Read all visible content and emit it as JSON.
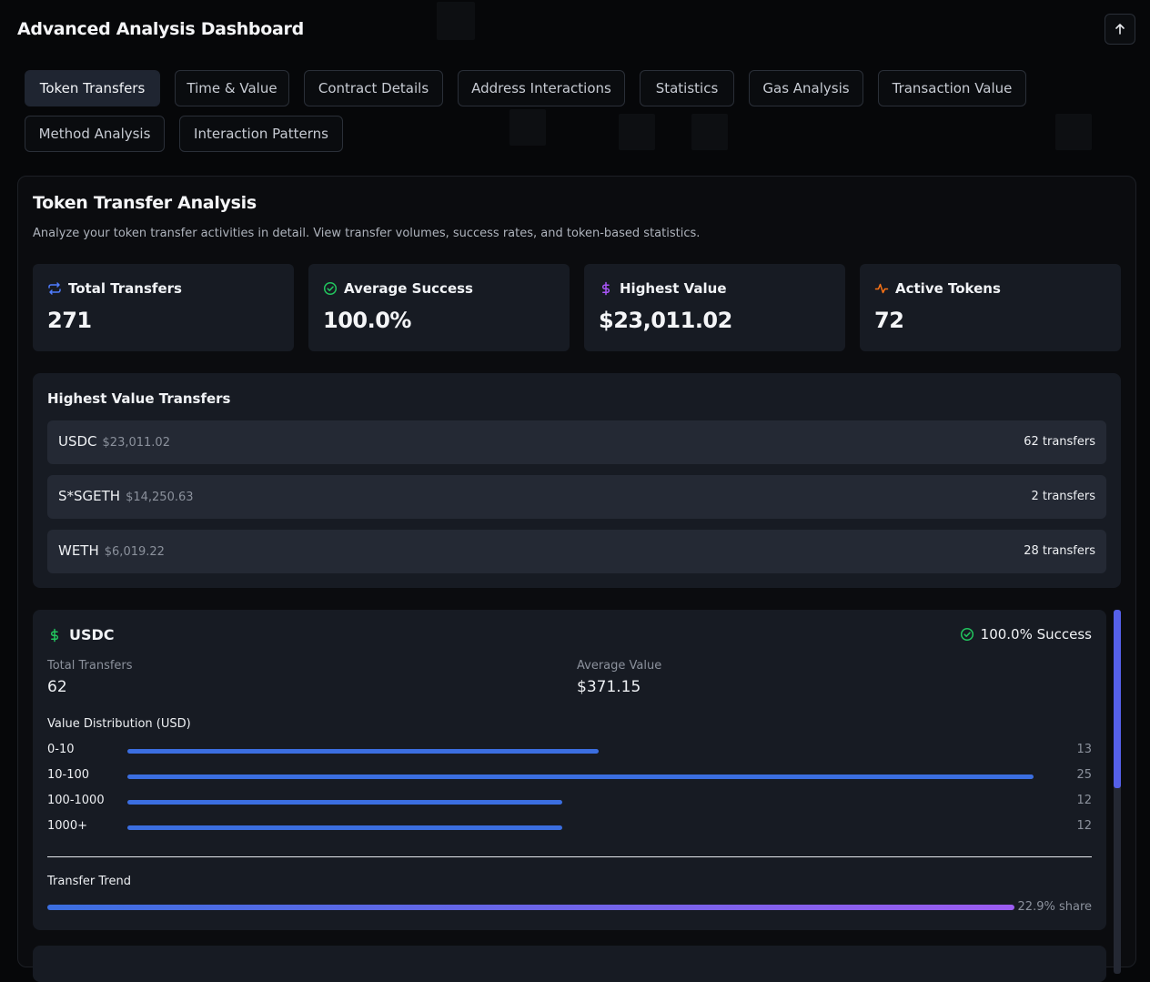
{
  "header": {
    "title": "Advanced Analysis Dashboard"
  },
  "tabs": [
    {
      "label": "Token Transfers",
      "active": true
    },
    {
      "label": "Time & Value"
    },
    {
      "label": "Contract Details"
    },
    {
      "label": "Address Interactions"
    },
    {
      "label": "Statistics"
    },
    {
      "label": "Gas Analysis"
    },
    {
      "label": "Transaction Value"
    },
    {
      "label": "Method Analysis"
    },
    {
      "label": "Interaction Patterns"
    }
  ],
  "panel": {
    "title": "Token Transfer Analysis",
    "description": "Analyze your token transfer activities in detail. View transfer volumes, success rates, and token-based statistics."
  },
  "stats": [
    {
      "label": "Total Transfers",
      "value": "271",
      "icon": "repeat-icon",
      "color": "#4f7cff"
    },
    {
      "label": "Average Success",
      "value": "100.0%",
      "icon": "check-circle-icon",
      "color": "#22c55e"
    },
    {
      "label": "Highest Value",
      "value": "$23,011.02",
      "icon": "dollar-icon",
      "color": "#a855f7"
    },
    {
      "label": "Active Tokens",
      "value": "72",
      "icon": "activity-icon",
      "color": "#f97316"
    }
  ],
  "highest_value": {
    "title": "Highest Value Transfers",
    "rows": [
      {
        "token": "USDC",
        "amount": "$23,011.02",
        "count": "62 transfers"
      },
      {
        "token": "S*SGETH",
        "amount": "$14,250.63",
        "count": "2 transfers"
      },
      {
        "token": "WETH",
        "amount": "$6,019.22",
        "count": "28 transfers"
      }
    ]
  },
  "token_card": {
    "token": "USDC",
    "success": "100.0% Success",
    "total_label": "Total Transfers",
    "total_value": "62",
    "avg_label": "Average Value",
    "avg_value": "$371.15",
    "dist_title": "Value Distribution (USD)",
    "distribution": [
      {
        "range": "0-10",
        "count": "13",
        "fraction": 0.52
      },
      {
        "range": "10-100",
        "count": "25",
        "fraction": 1.0
      },
      {
        "range": "100-1000",
        "count": "12",
        "fraction": 0.48
      },
      {
        "range": "1000+",
        "count": "12",
        "fraction": 0.48
      }
    ],
    "trend_title": "Transfer Trend",
    "trend_share": "22.9% share",
    "trend_fraction": 1.0
  },
  "colors": {
    "accent": "#3b6ee0",
    "purple": "#9b5cf0",
    "success": "#22c55e"
  }
}
